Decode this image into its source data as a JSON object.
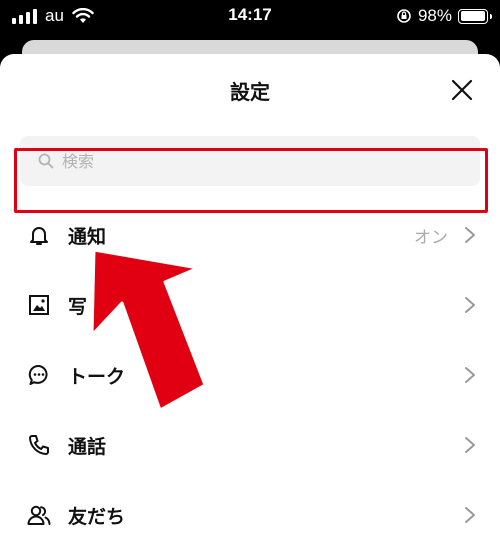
{
  "status_bar": {
    "carrier": "au",
    "time": "14:17",
    "battery_percent": "98%",
    "battery_level": 0.98
  },
  "sheet": {
    "title": "設定",
    "close_icon": "close-icon"
  },
  "search": {
    "placeholder": "検索",
    "value": ""
  },
  "settings_items": [
    {
      "label": "通知",
      "value": "オン",
      "icon": "bell-icon"
    },
    {
      "label": "写",
      "value": "",
      "icon": "photo-icon"
    },
    {
      "label": "トーク",
      "value": "",
      "icon": "chat-bubble-icon"
    },
    {
      "label": "通話",
      "value": "",
      "icon": "phone-icon"
    },
    {
      "label": "友だち",
      "value": "",
      "icon": "friends-icon"
    }
  ],
  "annotation": {
    "highlight_color": "#e00012",
    "arrow_color": "#e00012"
  }
}
